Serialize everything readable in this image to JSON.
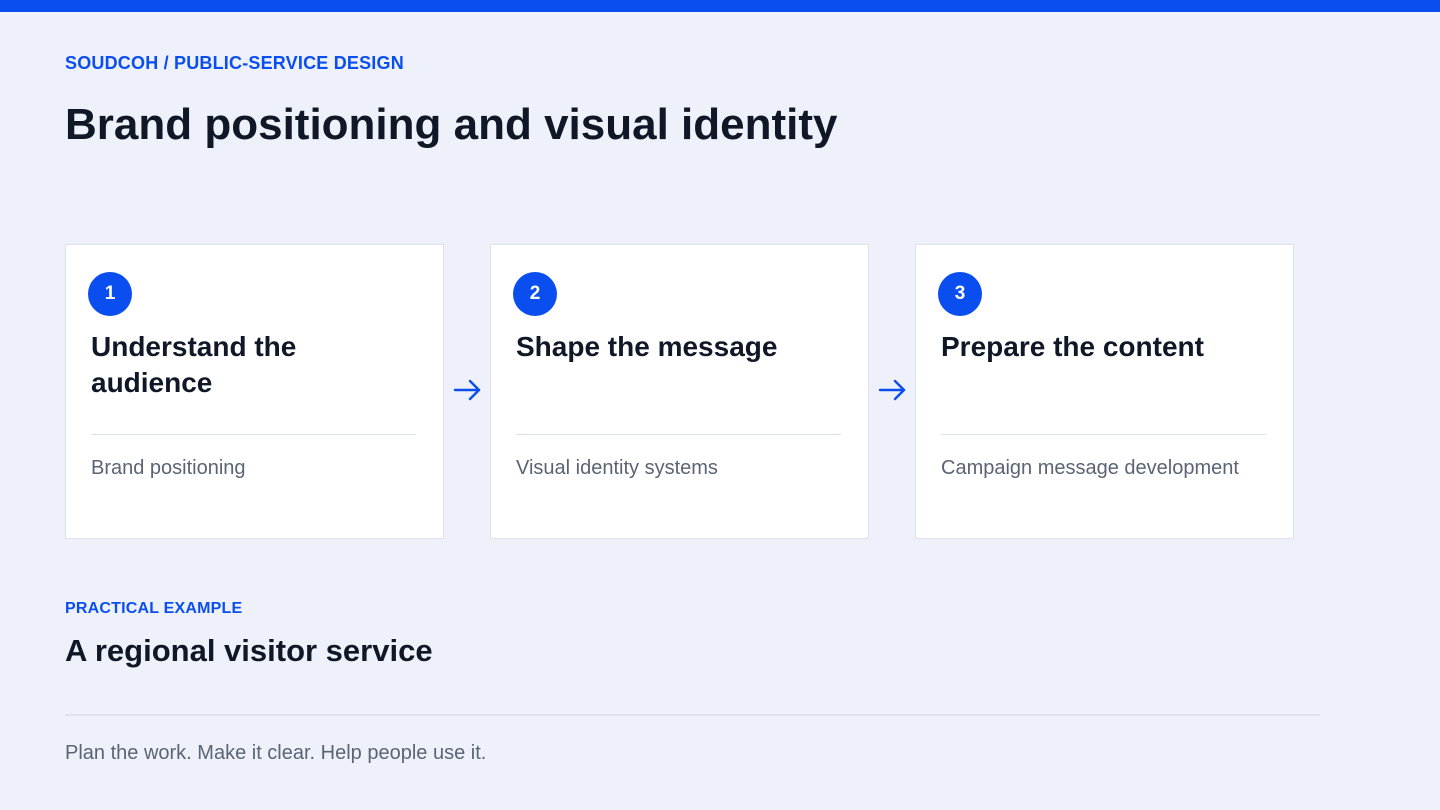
{
  "header": {
    "eyebrow": "SOUDCOH / PUBLIC-SERVICE DESIGN",
    "title": "Brand positioning and visual identity"
  },
  "steps": [
    {
      "number": "1",
      "title": "Understand the audience",
      "description": "Brand positioning"
    },
    {
      "number": "2",
      "title": "Shape the message",
      "description": "Visual identity systems"
    },
    {
      "number": "3",
      "title": "Prepare the content",
      "description": "Campaign message development"
    }
  ],
  "arrows": [
    {
      "icon": "arrow-right-icon"
    },
    {
      "icon": "arrow-right-icon"
    }
  ],
  "example": {
    "label": "PRACTICAL EXAMPLE",
    "title": "A regional visitor service"
  },
  "footer": {
    "tagline": "Plan the work. Make it clear. Help people use it."
  },
  "colors": {
    "accent": "#0b4ef0",
    "background": "#eef1f9",
    "card": "#ffffff",
    "heading": "#101828",
    "muted": "#5b6474",
    "divider": "#dde2ec"
  }
}
